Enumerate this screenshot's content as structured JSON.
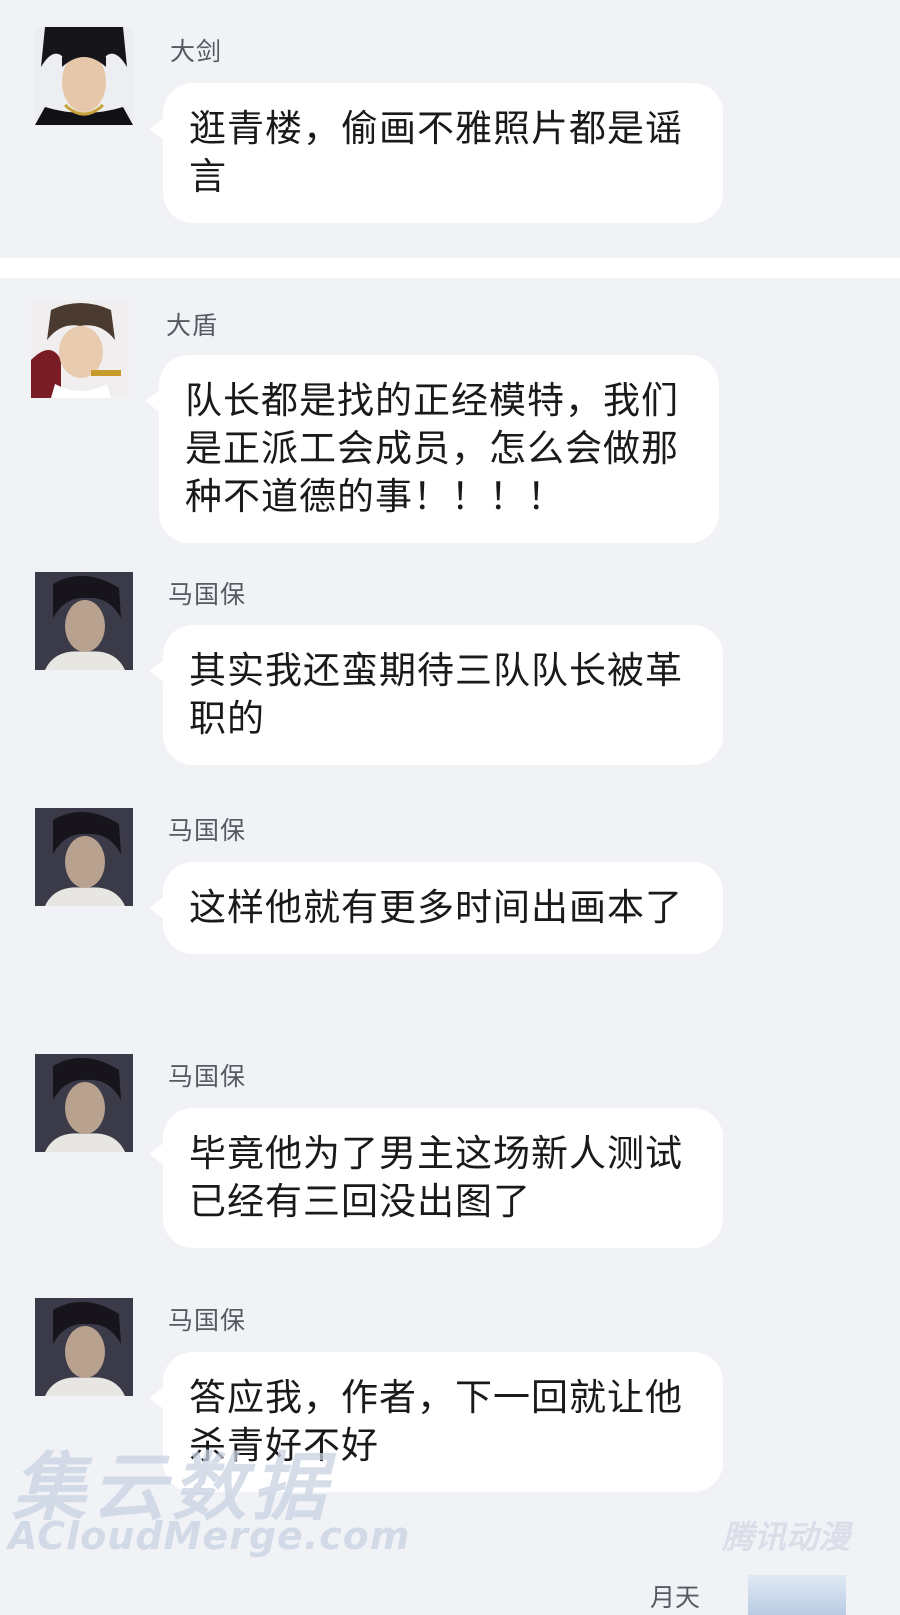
{
  "messages": [
    {
      "sender": "大剑",
      "text": "逛青楼，偷画不雅照片都是谣言",
      "avatar": "dajian-avatar"
    },
    {
      "sender": "大盾",
      "text": "队长都是找的正经模特，我们是正派工会成员，怎么会做那种不道德的事！！！！",
      "avatar": "dadun-avatar"
    },
    {
      "sender": "马国保",
      "text": "其实我还蛮期待三队队长被革职的",
      "avatar": "maguobao-avatar"
    },
    {
      "sender": "马国保",
      "text": "这样他就有更多时间出画本了",
      "avatar": "maguobao-avatar"
    },
    {
      "sender": "马国保",
      "text": "毕竟他为了男主这场新人测试已经有三回没出图了",
      "avatar": "maguobao-avatar"
    },
    {
      "sender": "马国保",
      "text": "答应我，作者，下一回就让他杀青好不好",
      "avatar": "maguobao-avatar"
    }
  ],
  "partial_sender": "月天",
  "watermark": {
    "chinese": "集云数据",
    "english": "ACloudMerge.com",
    "logo": "腾讯动漫"
  },
  "colors": {
    "background": "#f1f2f6",
    "bubble": "#ffffff",
    "name": "#555a63",
    "text": "#1a1a1a"
  }
}
